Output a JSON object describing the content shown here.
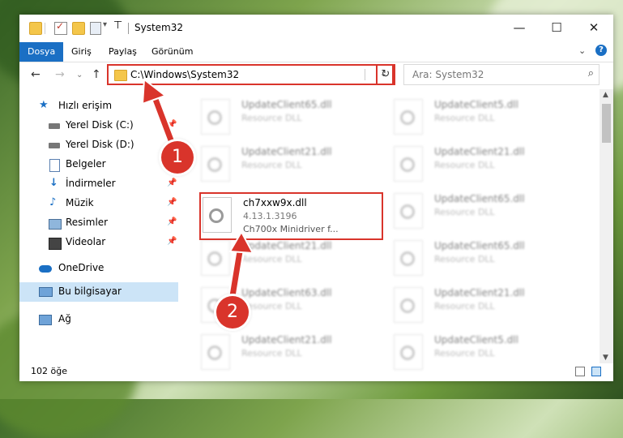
{
  "window": {
    "title": "System32"
  },
  "ribbon": {
    "tabs": [
      "Dosya",
      "Giriş",
      "Paylaş",
      "Görünüm"
    ]
  },
  "address": {
    "path": "C:\\Windows\\System32"
  },
  "search": {
    "placeholder": "Ara: System32"
  },
  "sidebar": {
    "items": [
      {
        "label": "Hızlı erişim",
        "icon": "star-icon"
      },
      {
        "label": "Yerel Disk (C:)",
        "icon": "drive-icon"
      },
      {
        "label": "Yerel Disk (D:)",
        "icon": "drive-icon"
      },
      {
        "label": "Belgeler",
        "icon": "document-icon"
      },
      {
        "label": "İndirmeler",
        "icon": "download-icon"
      },
      {
        "label": "Müzik",
        "icon": "music-icon"
      },
      {
        "label": "Resimler",
        "icon": "pictures-icon"
      },
      {
        "label": "Videolar",
        "icon": "video-icon"
      },
      {
        "label": "OneDrive",
        "icon": "cloud-icon"
      },
      {
        "label": "Bu bilgisayar",
        "icon": "computer-icon"
      },
      {
        "label": "Ağ",
        "icon": "network-icon"
      }
    ]
  },
  "files": [
    {
      "name": "UpdateClient65.dll",
      "line1": "Resource DLL",
      "line2": ""
    },
    {
      "name": "UpdateClient5.dll",
      "line1": "Resource DLL",
      "line2": ""
    },
    {
      "name": "UpdateClient21.dll",
      "line1": "Resource DLL",
      "line2": ""
    },
    {
      "name": "UpdateClient21.dll",
      "line1": "Resource DLL",
      "line2": ""
    },
    {
      "name": "ch7xxw9x.dll",
      "line1": "4.13.1.3196",
      "line2": "Ch700x Minidriver f..."
    },
    {
      "name": "UpdateClient65.dll",
      "line1": "Resource DLL",
      "line2": ""
    },
    {
      "name": "UpdateClient21.dll",
      "line1": "Resource DLL",
      "line2": ""
    },
    {
      "name": "UpdateClient65.dll",
      "line1": "Resource DLL",
      "line2": ""
    },
    {
      "name": "UpdateClient63.dll",
      "line1": "Resource DLL",
      "line2": ""
    },
    {
      "name": "UpdateClient21.dll",
      "line1": "Resource DLL",
      "line2": ""
    },
    {
      "name": "UpdateClient21.dll",
      "line1": "Resource DLL",
      "line2": ""
    },
    {
      "name": "UpdateClient5.dll",
      "line1": "Resource DLL",
      "line2": ""
    }
  ],
  "status": {
    "count": "102 öğe"
  },
  "annotations": {
    "step1": "1",
    "step2": "2"
  },
  "colors": {
    "accent": "#1a6fc4",
    "highlight": "#d9342b",
    "selection": "#cce4f7"
  }
}
